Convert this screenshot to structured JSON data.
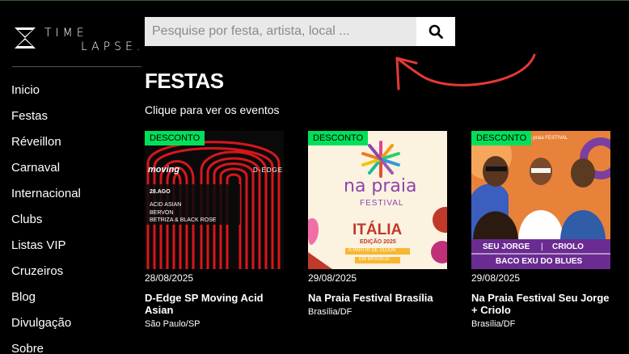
{
  "brand": {
    "line1": "TIME",
    "line2": "LAPSE."
  },
  "search": {
    "placeholder": "Pesquise por festa, artista, local ..."
  },
  "sidebar": {
    "items": [
      {
        "label": "Inicio"
      },
      {
        "label": "Festas"
      },
      {
        "label": "Réveillon"
      },
      {
        "label": "Carnaval"
      },
      {
        "label": "Internacional"
      },
      {
        "label": "Clubs"
      },
      {
        "label": "Listas VIP"
      },
      {
        "label": "Cruzeiros"
      },
      {
        "label": "Blog"
      },
      {
        "label": "Divulgação"
      },
      {
        "label": "Sobre"
      }
    ]
  },
  "main": {
    "title": "FESTAS",
    "subtitle": "Clique para ver os eventos",
    "cards": [
      {
        "badge": "DESCONTO",
        "date": "28/08/2025",
        "title": "D-Edge SP Moving Acid Asian",
        "location": "São Paulo/SP",
        "poster": {
          "brand": "moving",
          "venue": "D-EDGE",
          "date": "28.AGO",
          "lineup": [
            "ACID ASIAN",
            "BERVON",
            "BETRIZA & BLACK ROSE"
          ]
        }
      },
      {
        "badge": "DESCONTO",
        "date": "29/08/2025",
        "title": "Na Praia Festival Brasília",
        "location": "Brasília/DF",
        "poster": {
          "brand": "na praia",
          "sub": "FESTIVAL",
          "country": "ITÁLIA",
          "edition": "EDIÇÃO 2025",
          "note": "A PARTIR DE 21/JUN",
          "place": "EM BRASÍLIA"
        }
      },
      {
        "badge": "DESCONTO",
        "date": "29/08/2025",
        "title": "Na Praia Festival Seu Jorge + Criolo",
        "location": "Brasília/DF",
        "poster": {
          "brand": "na praia FESTIVAL",
          "artists": [
            "SEU JORGE",
            "CRIOLO"
          ],
          "headline": "BACO EXU DO BLUES"
        }
      }
    ]
  },
  "colors": {
    "accent": "#00e05a",
    "background": "#000000",
    "arrow": "#e53935"
  }
}
